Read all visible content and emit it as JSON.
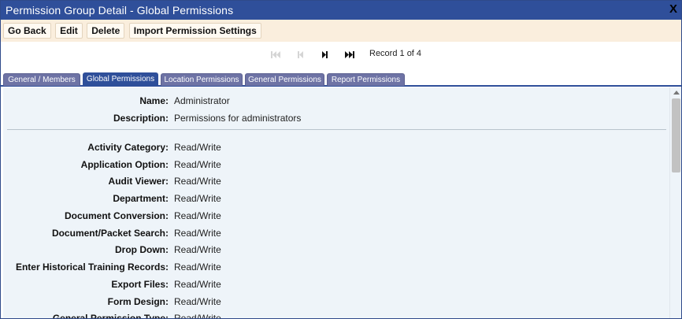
{
  "window": {
    "title": "Permission Group Detail - Global Permissions",
    "close_label": "X"
  },
  "toolbar": {
    "go_back": "Go Back",
    "edit": "Edit",
    "delete": "Delete",
    "import": "Import Permission Settings"
  },
  "pager": {
    "record_text": "Record 1 of 4",
    "icons": [
      "first-page-icon",
      "previous-page-icon",
      "next-page-icon",
      "last-page-icon"
    ]
  },
  "tabs": [
    {
      "label": "General / Members",
      "active": false
    },
    {
      "label": "Global Permissions",
      "active": true
    },
    {
      "label": "Location Permissions",
      "active": false
    },
    {
      "label": "General Permissions",
      "active": false
    },
    {
      "label": "Report Permissions",
      "active": false
    }
  ],
  "header": {
    "name_label": "Name:",
    "name_value": "Administrator",
    "description_label": "Description:",
    "description_value": "Permissions for administrators"
  },
  "permissions": [
    {
      "label": "Activity Category:",
      "value": "Read/Write"
    },
    {
      "label": "Application Option:",
      "value": "Read/Write"
    },
    {
      "label": "Audit Viewer:",
      "value": "Read/Write"
    },
    {
      "label": "Department:",
      "value": "Read/Write"
    },
    {
      "label": "Document Conversion:",
      "value": "Read/Write"
    },
    {
      "label": "Document/Packet Search:",
      "value": "Read/Write"
    },
    {
      "label": "Drop Down:",
      "value": "Read/Write"
    },
    {
      "label": "Enter Historical Training Records:",
      "value": "Read/Write"
    },
    {
      "label": "Export Files:",
      "value": "Read/Write"
    },
    {
      "label": "Form Design:",
      "value": "Read/Write"
    },
    {
      "label": "General Permission Type:",
      "value": "Read/Write"
    }
  ],
  "colors": {
    "title_bar": "#2f4f9a",
    "toolbar_bg": "#faeedd",
    "tab_inactive": "#6e73a5",
    "tab_active": "#2f4f9a",
    "panel_bg": "#eef4f9"
  }
}
